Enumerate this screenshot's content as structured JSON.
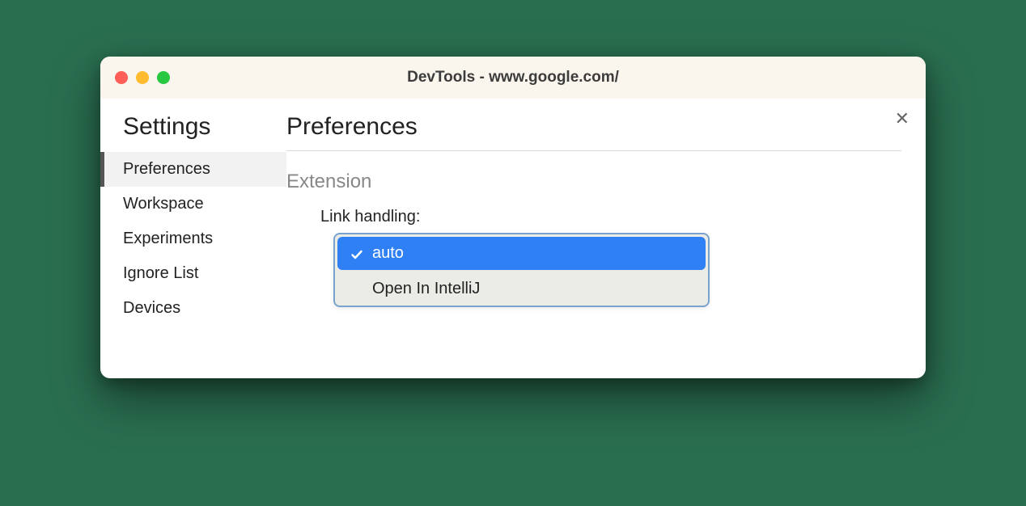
{
  "window": {
    "title": "DevTools - www.google.com/"
  },
  "sidebar": {
    "title": "Settings",
    "items": [
      {
        "label": "Preferences",
        "active": true
      },
      {
        "label": "Workspace",
        "active": false
      },
      {
        "label": "Experiments",
        "active": false
      },
      {
        "label": "Ignore List",
        "active": false
      },
      {
        "label": "Devices",
        "active": false
      }
    ]
  },
  "main": {
    "title": "Preferences",
    "section": "Extension",
    "field_label": "Link handling:",
    "dropdown": {
      "options": [
        {
          "label": "auto",
          "selected": true
        },
        {
          "label": "Open In IntelliJ",
          "selected": false
        }
      ]
    }
  }
}
